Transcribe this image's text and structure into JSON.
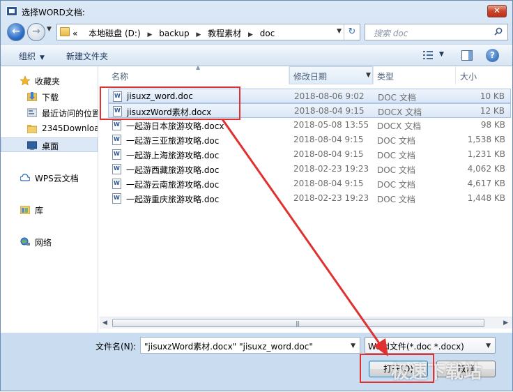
{
  "window": {
    "title": "选择WORD文档:",
    "close_label": "✕"
  },
  "nav": {
    "back_glyph": "←",
    "forward_glyph": "→",
    "crumbs": [
      "«",
      "本地磁盘 (D:)",
      "backup",
      "教程素材",
      "doc"
    ],
    "search_placeholder": "搜索 doc",
    "refresh_glyph": "↻"
  },
  "toolbar": {
    "organize_label": "组织",
    "new_folder_label": "新建文件夹",
    "help_label": "?"
  },
  "sidebar": {
    "items": [
      {
        "label": "收藏夹",
        "icon": "star-icon"
      },
      {
        "label": "下载",
        "icon": "download-folder-icon"
      },
      {
        "label": "最近访问的位置",
        "icon": "recent-places-icon"
      },
      {
        "label": "2345Downloa",
        "icon": "folder-icon"
      },
      {
        "label": "桌面",
        "icon": "desktop-icon"
      },
      {
        "label": "WPS云文档",
        "icon": "cloud-icon"
      },
      {
        "label": "库",
        "icon": "library-icon"
      },
      {
        "label": "网络",
        "icon": "network-icon"
      }
    ]
  },
  "columns": {
    "name": "名称",
    "date": "修改日期",
    "type": "类型",
    "size": "大小"
  },
  "files": [
    {
      "name": "jisuxz_word.doc",
      "date": "2018-08-06 9:02",
      "type": "DOC 文档",
      "size": "10 KB",
      "selected": true
    },
    {
      "name": "jisuxzWord素材.docx",
      "date": "2018-08-04 9:15",
      "type": "DOCX 文档",
      "size": "12 KB",
      "selected": true
    },
    {
      "name": "一起游日本旅游攻略.docx",
      "date": "2018-05-08 13:55",
      "type": "DOCX 文档",
      "size": "98 KB",
      "selected": false
    },
    {
      "name": "一起游三亚旅游攻略.doc",
      "date": "2018-08-04 9:15",
      "type": "DOC 文档",
      "size": "1,538 KB",
      "selected": false
    },
    {
      "name": "一起游上海旅游攻略.doc",
      "date": "2018-08-04 9:15",
      "type": "DOC 文档",
      "size": "1,231 KB",
      "selected": false
    },
    {
      "name": "一起游西藏旅游攻略.doc",
      "date": "2018-02-23 19:23",
      "type": "DOC 文档",
      "size": "4,062 KB",
      "selected": false
    },
    {
      "name": "一起游云南旅游攻略.doc",
      "date": "2018-08-04 9:15",
      "type": "DOC 文档",
      "size": "4,617 KB",
      "selected": false
    },
    {
      "name": "一起游重庆旅游攻略.doc",
      "date": "2018-02-23 19:23",
      "type": "DOC 文档",
      "size": "1,448 KB",
      "selected": false
    }
  ],
  "bottom": {
    "filename_label": "文件名(N):",
    "filename_value": "\"jisuxzWord素材.docx\" \"jisuxz_word.doc\"",
    "filter_value": "Word文件(*.doc *.docx)",
    "open_label": "打开(O)",
    "cancel_label": "取消"
  },
  "watermark": "极速下载站",
  "colors": {
    "annotation_red": "#e0302f",
    "selection_blue": "#dae7f7"
  }
}
